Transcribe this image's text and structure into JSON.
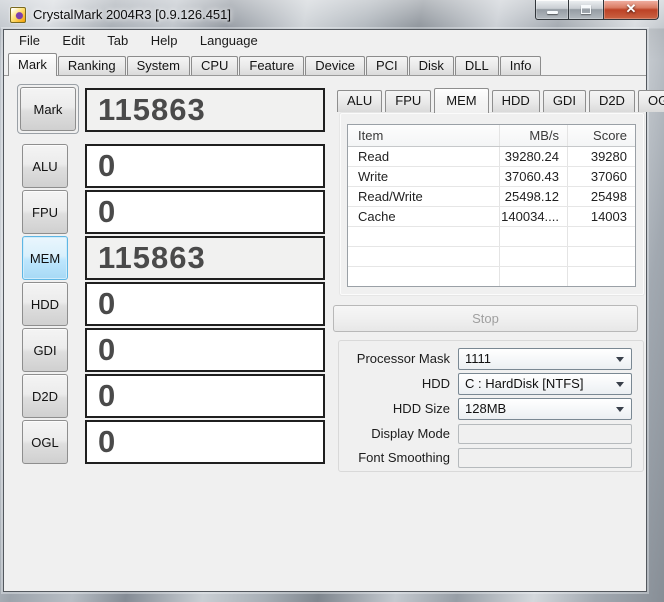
{
  "window": {
    "title": "CrystalMark 2004R3 [0.9.126.451]"
  },
  "icons": {
    "close": "✕"
  },
  "menu": {
    "items": [
      "File",
      "Edit",
      "Tab",
      "Help",
      "Language"
    ]
  },
  "main_tabs": {
    "active": "Mark",
    "items": [
      "Mark",
      "Ranking",
      "System",
      "CPU",
      "Feature",
      "Device",
      "PCI",
      "Disk",
      "DLL",
      "Info"
    ]
  },
  "benchmarks": {
    "rows": [
      {
        "button": "Mark",
        "score": "115863"
      },
      {
        "button": "ALU",
        "score": "0"
      },
      {
        "button": "FPU",
        "score": "0"
      },
      {
        "button": "MEM",
        "score": "115863"
      },
      {
        "button": "HDD",
        "score": "0"
      },
      {
        "button": "GDI",
        "score": "0"
      },
      {
        "button": "D2D",
        "score": "0"
      },
      {
        "button": "OGL",
        "score": "0"
      }
    ]
  },
  "result_tabs": {
    "active": "MEM",
    "items": [
      "ALU",
      "FPU",
      "MEM",
      "HDD",
      "GDI",
      "D2D",
      "OGL"
    ]
  },
  "result_table": {
    "headers": [
      "Item",
      "MB/s",
      "Score"
    ],
    "rows": [
      {
        "item": "Read",
        "mbs": "39280.24",
        "score": "39280"
      },
      {
        "item": "Write",
        "mbs": "37060.43",
        "score": "37060"
      },
      {
        "item": "Read/Write",
        "mbs": "25498.12",
        "score": "25498"
      },
      {
        "item": "Cache",
        "mbs": "140034....",
        "score": "14003"
      }
    ]
  },
  "controls": {
    "stop_label": "Stop",
    "fields": [
      {
        "label": "Processor Mask",
        "value": "1111",
        "enabled": true
      },
      {
        "label": "HDD",
        "value": "C : HardDisk [NTFS]",
        "enabled": true
      },
      {
        "label": "HDD Size",
        "value": "128MB",
        "enabled": true
      },
      {
        "label": "Display Mode",
        "value": "",
        "enabled": false
      },
      {
        "label": "Font Smoothing",
        "value": "",
        "enabled": false
      }
    ]
  }
}
